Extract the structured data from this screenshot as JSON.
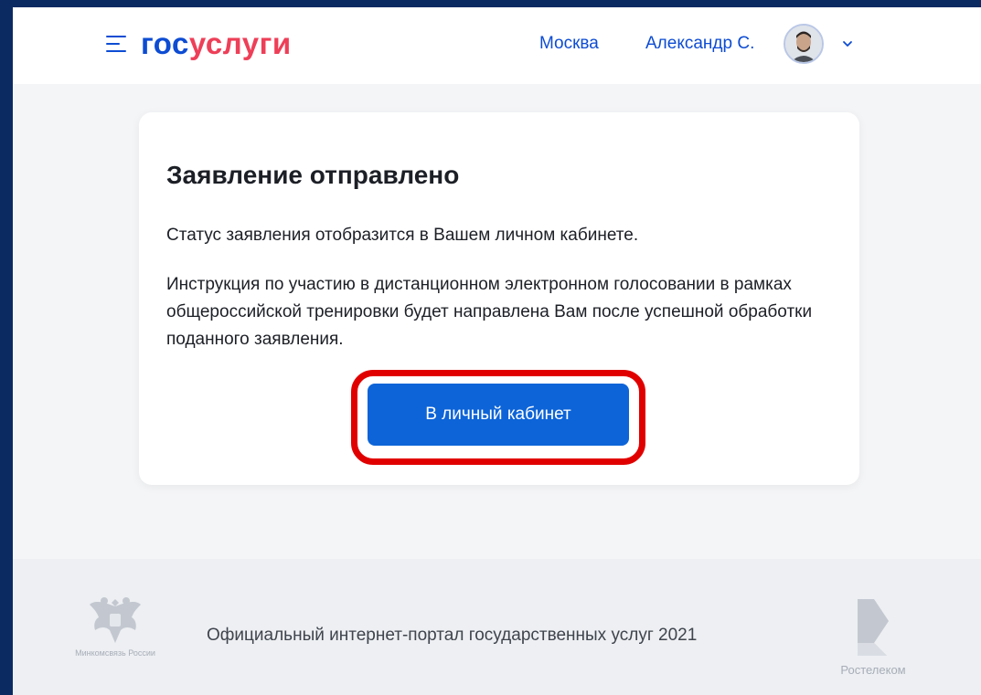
{
  "header": {
    "logo_part1": "гос",
    "logo_part2": "услуги",
    "city": "Москва",
    "user_name": "Александр С.",
    "colors": {
      "brand_blue": "#0d4cd3",
      "brand_red": "#ee3f58"
    }
  },
  "card": {
    "title": "Заявление отправлено",
    "status_text": "Статус заявления отобразится в Вашем личном кабинете.",
    "instruction_text": "Инструкция по участию в дистанционном электронном голосовании в рамках общероссийской тренировки будет направлена Вам после успешной обработки поданного заявления.",
    "button_label": "В личный кабинет",
    "highlight_color": "#e10000"
  },
  "footer": {
    "ministry_label": "Минкомсвязь России",
    "text": "Официальный интернет-портал государственных услуг 2021",
    "partner_label": "Ростелеком"
  },
  "icons": [
    "menu-icon",
    "chevron-down-icon",
    "avatar",
    "russian-coat-of-arms-icon",
    "rostelecom-logo-icon"
  ]
}
